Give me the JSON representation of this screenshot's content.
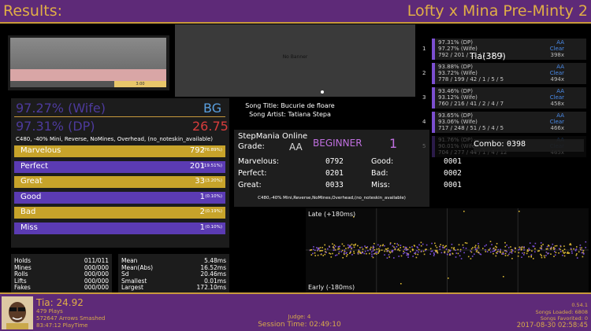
{
  "header": {
    "left_title": "Results:",
    "right_title": "Lofty x Mina Pre-Minty 2"
  },
  "banner": {
    "text": "No Banner"
  },
  "life_graph": {
    "label": "3:00"
  },
  "score": {
    "wife_pct": "97.27% (Wife)",
    "dp_pct": "97.31% (DP)",
    "msd_label": "BG",
    "msd_value": "26.75",
    "mods": "C480, -40% Mini, Reverse, NoMines, Overhead, (no_noteskin_available)"
  },
  "judgments": [
    {
      "label": "Marvelous",
      "count": "792",
      "pct": "(76.89%)",
      "color": "#c7a32a",
      "fraction": 0.77
    },
    {
      "label": "Perfect",
      "count": "201",
      "pct": "(19.51%)",
      "color": "#5b3bb3",
      "fraction": 0.2
    },
    {
      "label": "Great",
      "count": "33",
      "pct": "(3.20%)",
      "color": "#c7a32a",
      "fraction": 0.032
    },
    {
      "label": "Good",
      "count": "1",
      "pct": "(0.10%)",
      "color": "#5b3bb3",
      "fraction": 0.001
    },
    {
      "label": "Bad",
      "count": "2",
      "pct": "(0.19%)",
      "color": "#c7a32a",
      "fraction": 0.002
    },
    {
      "label": "Miss",
      "count": "1",
      "pct": "(0.10%)",
      "color": "#5b3bb3",
      "fraction": 0.001
    }
  ],
  "song": {
    "title_line": "Song Title: Bucurie de floare",
    "artist_line": "Song Artist: Tatiana Stepa"
  },
  "online": {
    "heading": "StepMania Online",
    "player": "Tia(389)",
    "grade_label": "Grade:",
    "grade": "AA",
    "difficulty": "BEGINNER",
    "meter": "1",
    "combo_label": "Combo:",
    "combo": "0398",
    "rows": [
      {
        "l": "Marvelous:",
        "lv": "0792",
        "r": "Good:",
        "rv": "0001"
      },
      {
        "l": "Perfect:",
        "lv": "0201",
        "r": "Bad:",
        "rv": "0002"
      },
      {
        "l": "Great:",
        "lv": "0033",
        "r": "Miss:",
        "rv": "0001"
      }
    ],
    "mods": "C480,-40% Mini,Reverse,NoMines,Overhead,(no_noteskin_available)"
  },
  "scoreboard": [
    {
      "rank": "1",
      "dp": "97.31% (DP)",
      "wife": "97.27% (Wife)",
      "notes": "792 / 201 / 33 / 1 / 2 / 1",
      "grade": "AA",
      "clear": "Clear",
      "max": "398x"
    },
    {
      "rank": "2",
      "dp": "93.88% (DP)",
      "wife": "93.72% (Wife)",
      "notes": "778 / 199 / 42 / 1 / 5 / 5",
      "grade": "AA",
      "clear": "Clear",
      "max": "494x"
    },
    {
      "rank": "3",
      "dp": "93.46% (DP)",
      "wife": "93.12% (Wife)",
      "notes": "760 / 216 / 41 / 2 / 4 / 7",
      "grade": "AA",
      "clear": "Clear",
      "max": "458x"
    },
    {
      "rank": "4",
      "dp": "93.65% (DP)",
      "wife": "93.06% (Wife)",
      "notes": "717 / 248 / 51 / 5 / 4 / 5",
      "grade": "AA",
      "clear": "Clear",
      "max": "466x"
    },
    {
      "rank": "5",
      "dp": "91.76% (DP)",
      "wife": "90.01% (Wife)",
      "notes": "704 / 277 / 44 / 1 / 4 / 12",
      "grade": "AA",
      "clear": "Clear",
      "max": "465x"
    }
  ],
  "radar": [
    {
      "label": "Holds",
      "value": "011/011"
    },
    {
      "label": "Mines",
      "value": "000/000"
    },
    {
      "label": "Rolls",
      "value": "000/000"
    },
    {
      "label": "Lifts",
      "value": "000/000"
    },
    {
      "label": "Fakes",
      "value": "000/000"
    }
  ],
  "offset_stats": [
    {
      "label": "Mean",
      "value": "5.48ms"
    },
    {
      "label": "Mean(Abs)",
      "value": "16.52ms"
    },
    {
      "label": "Sd",
      "value": "20.46ms"
    },
    {
      "label": "Smallest",
      "value": "0.01ms"
    },
    {
      "label": "Largest",
      "value": "172.10ms"
    }
  ],
  "offset_plot": {
    "late_label": "Late (+180ms)",
    "early_label": "Early (-180ms)"
  },
  "footer": {
    "profile_name": "Tia: 24.92",
    "plays": "479 Plays",
    "arrows": "572647 Arrows Smashed",
    "playtime": "83:47:12 PlayTime",
    "judge": "Judge: 4",
    "session": "Session Time: 02:49:10",
    "version": "0.54.1",
    "songs_loaded": "Songs Loaded: 6808",
    "songs_favorited": "Songs Favorited: 0",
    "datetime": "2017-08-30 02:58:45"
  }
}
